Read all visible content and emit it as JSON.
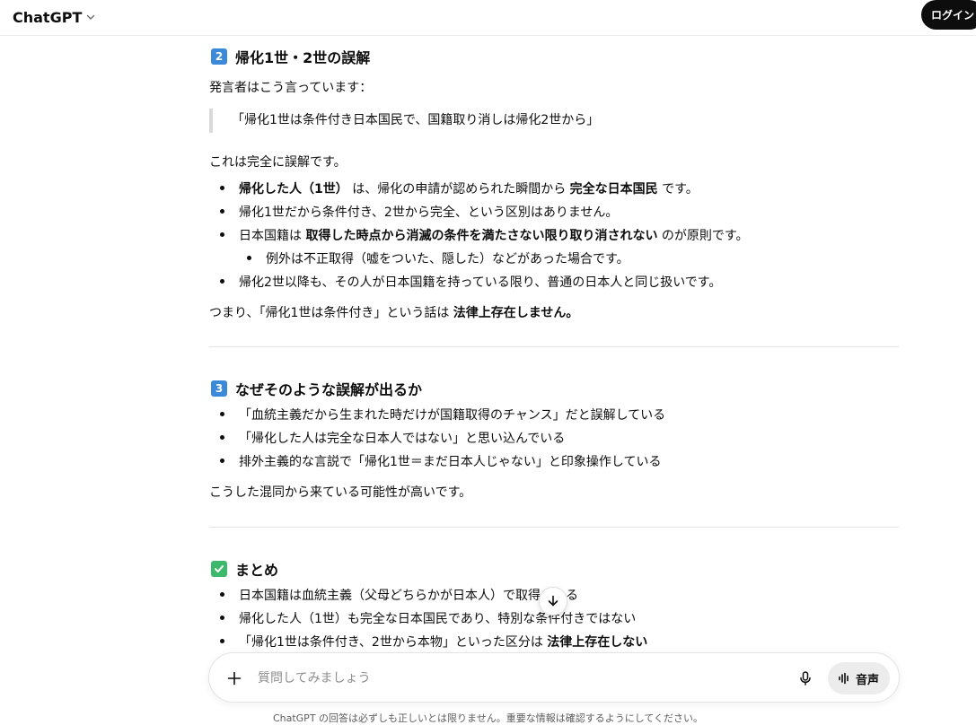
{
  "header": {
    "model_name": "ChatGPT",
    "login_label": "ログイン"
  },
  "section2": {
    "num": "2",
    "title": "帰化1世・2世の誤解",
    "intro": "発言者はこう言っています：",
    "quote": "「帰化1世は条件付き日本国民で、国籍取り消しは帰化2世から」",
    "statement": "これは完全に誤解です。",
    "li1": {
      "b1": "帰化した人（1世）",
      "t1": " は、帰化の申請が認められた瞬間から ",
      "b2": "完全な日本国民",
      "t2": " です。"
    },
    "li2": "帰化1世だから条件付き、2世から完全、という区別はありません。",
    "li3": {
      "t1": "日本国籍は ",
      "b1": "取得した時点から消滅の条件を満たさない限り取り消されない",
      "t2": " のが原則です。"
    },
    "li3_sub": "例外は不正取得（嘘をついた、隠した）などがあった場合です。",
    "li4": "帰化2世以降も、その人が日本国籍を持っている限り、普通の日本人と同じ扱いです。",
    "conclusion": {
      "t1": "つまり、「帰化1世は条件付き」という話は ",
      "b1": "法律上存在しません。"
    }
  },
  "section3": {
    "num": "3",
    "title": "なぜそのような誤解が出るか",
    "items": [
      "「血統主義だから生まれた時だけが国籍取得のチャンス」だと誤解している",
      "「帰化した人は完全な日本人ではない」と思い込んでいる",
      "排外主義的な言説で「帰化1世＝まだ日本人じゃない」と印象操作している"
    ],
    "conclusion": "こうした混同から来ている可能性が高いです。"
  },
  "summary": {
    "title": "まとめ",
    "items": [
      "日本国籍は血統主義（父母どちらかが日本人）で取得される",
      "帰化した人（1世）も完全な日本国民であり、特別な条件付きではない"
    ],
    "li3": {
      "t1": "「帰化1世は条件付き、2世から本物」といった区分は ",
      "b1": "法律上存在しない"
    }
  },
  "composer": {
    "placeholder": "質問してみましょう",
    "voice_label": "音声"
  },
  "footer": {
    "disclaimer": "ChatGPT の回答は必ずしも正しいとは限りません。重要な情報は確認するようにしてください。"
  },
  "icons": {
    "keycap_2": "keycap-two-icon",
    "keycap_3": "keycap-three-icon",
    "check": "check-mark-button-icon",
    "chevron": "chevron-down-icon",
    "plus": "plus-icon",
    "mic": "microphone-icon",
    "voice": "voice-waveform-icon",
    "scroll": "arrow-down-icon"
  },
  "colors": {
    "keycap": "#3b8ad9",
    "check": "#3cb96a",
    "login_bg": "#0d0d0d",
    "voice_bg": "#ececec"
  }
}
